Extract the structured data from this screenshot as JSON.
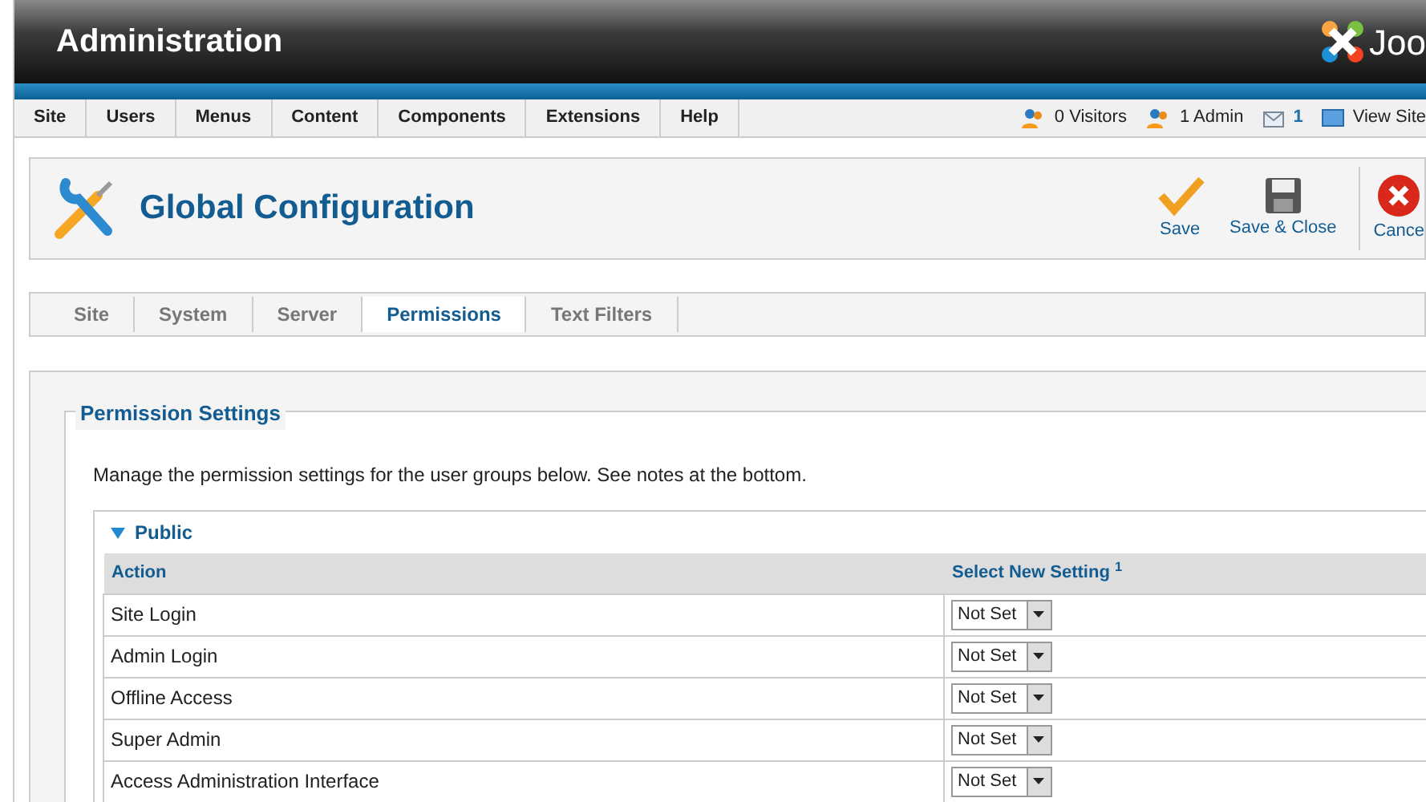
{
  "header": {
    "title": "Administration",
    "logo_text": "Joo"
  },
  "menu": [
    {
      "label": "Site"
    },
    {
      "label": "Users"
    },
    {
      "label": "Menus"
    },
    {
      "label": "Content"
    },
    {
      "label": "Components"
    },
    {
      "label": "Extensions"
    },
    {
      "label": "Help"
    }
  ],
  "status": [
    {
      "kind": "visitors",
      "text": "0 Visitors"
    },
    {
      "kind": "admin",
      "text": "1 Admin"
    },
    {
      "kind": "messages",
      "text": "1"
    },
    {
      "kind": "site",
      "text": "View Site"
    }
  ],
  "toolbar": {
    "title": "Global Configuration",
    "buttons": [
      {
        "kind": "save",
        "label": "Save"
      },
      {
        "kind": "save-close",
        "label": "Save & Close"
      },
      {
        "kind": "cancel",
        "label": "Cance"
      }
    ]
  },
  "tabs": [
    {
      "label": "Site",
      "selected": false
    },
    {
      "label": "System",
      "selected": false
    },
    {
      "label": "Server",
      "selected": false
    },
    {
      "label": "Permissions",
      "selected": true
    },
    {
      "label": "Text Filters",
      "selected": false
    }
  ],
  "fieldset": {
    "legend": "Permission Settings",
    "description": "Manage the permission settings for the user groups below. See notes at the bottom.",
    "group": {
      "name": "Public",
      "expanded": true,
      "columns": [
        "Action",
        "Select New Setting $^{1}$"
      ],
      "rows": [
        {
          "action": "Site Login",
          "setting": "Not Set"
        },
        {
          "action": "Admin Login",
          "setting": "Not Set"
        },
        {
          "action": "Offline Access",
          "setting": "Not Set"
        },
        {
          "action": "Super Admin",
          "setting": "Not Set"
        },
        {
          "action": "Access Administration Interface",
          "setting": "Not Set"
        }
      ]
    }
  }
}
